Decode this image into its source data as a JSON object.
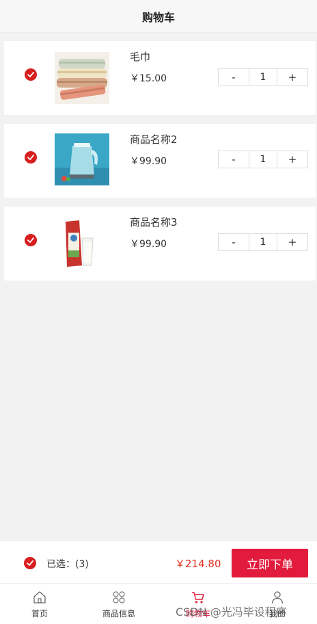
{
  "header": {
    "title": "购物车"
  },
  "items": [
    {
      "name": "毛巾",
      "price": "￥15.00",
      "qty": "1",
      "minus": "-",
      "plus": "+",
      "image": "towels"
    },
    {
      "name": "商品名称2",
      "price": "￥99.90",
      "qty": "1",
      "minus": "-",
      "plus": "+",
      "image": "kettle"
    },
    {
      "name": "商品名称3",
      "price": "￥99.90",
      "qty": "1",
      "minus": "-",
      "plus": "+",
      "image": "milk"
    }
  ],
  "footer": {
    "selected": "已选：(3)",
    "total": "￥214.80",
    "order_button": "立即下单"
  },
  "tabs": [
    {
      "label": "首页",
      "icon": "home-icon"
    },
    {
      "label": "商品信息",
      "icon": "grid-icon"
    },
    {
      "label": "购物车",
      "icon": "cart-icon"
    },
    {
      "label": "我的",
      "icon": "user-icon"
    }
  ],
  "watermark": "CSDN @光冯毕设程序",
  "colors": {
    "accent": "#e21b3c",
    "check": "#d81e1e",
    "price_total": "#e0301e"
  }
}
